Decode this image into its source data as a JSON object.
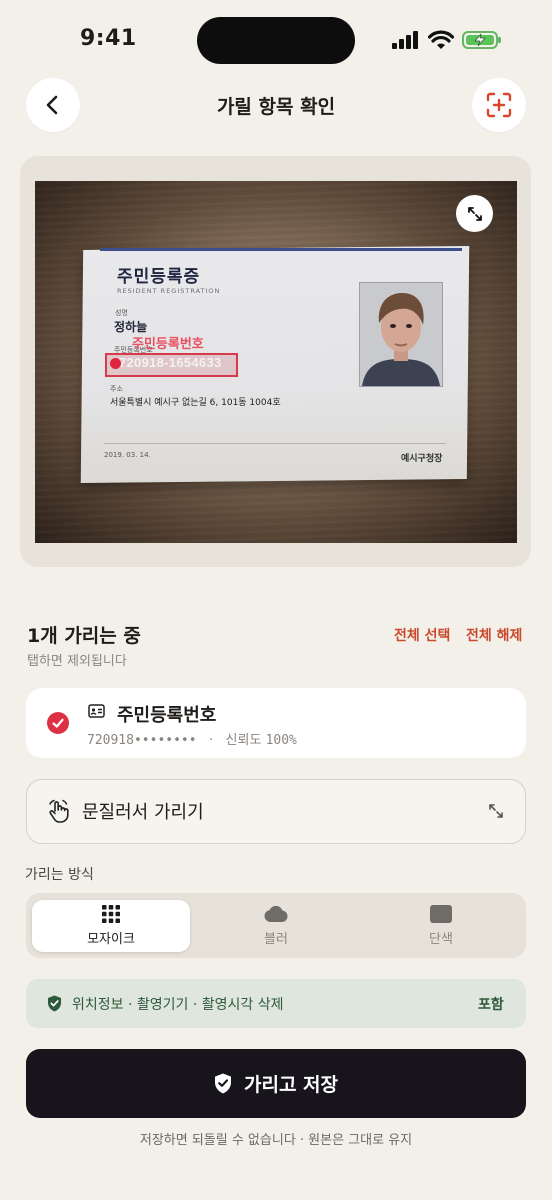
{
  "status": {
    "time": "9:41"
  },
  "header": {
    "title": "가릴 항목 확인",
    "back_icon": "chevron-left-icon",
    "scan_icon": "scan-add-icon"
  },
  "preview": {
    "card": {
      "title": "주민등록증",
      "subtitle": "RESIDENT REGISTRATION",
      "name_label": "성명",
      "name": "정하늘",
      "rrn_label": "주민등록번호",
      "overlay_label": "주민등록번호",
      "rrn_value": "720918-1654633",
      "address_label": "주소",
      "address": "서울특별시 예시구 없는길 6, 101동 1004호",
      "date": "2019. 03. 14.",
      "issuer": "예시구청장"
    }
  },
  "selection": {
    "title": "1개 가리는 중",
    "hint": "탭하면 제외됩니다",
    "select_all": "전체 선택",
    "deselect_all": "전체 해제"
  },
  "items": [
    {
      "title": "주민등록번호",
      "masked": "720918••••••••",
      "separator": "·",
      "confidence_label": "신뢰도",
      "confidence": "100%",
      "checked": true
    }
  ],
  "smudge": {
    "label": "문질러서 가리기"
  },
  "mode": {
    "title": "가리는 방식",
    "options": [
      {
        "label": "모자이크",
        "icon": "mosaic-icon",
        "selected": true
      },
      {
        "label": "블러",
        "icon": "cloud-blur-icon",
        "selected": false
      },
      {
        "label": "단색",
        "icon": "solid-square-icon",
        "selected": false
      }
    ]
  },
  "metadata": {
    "text": "위치정보 · 촬영기기 · 촬영시각 삭제",
    "tag": "포함"
  },
  "primary": {
    "label": "가리고 저장"
  },
  "footnote": "저장하면 되돌릴 수 없습니다 · 원본은 그대로 유지",
  "colors": {
    "accent": "#dc3145",
    "link": "#c94a2c",
    "dark": "#17141c",
    "success": "#2f5a3b",
    "background": "#f3f0ea"
  }
}
